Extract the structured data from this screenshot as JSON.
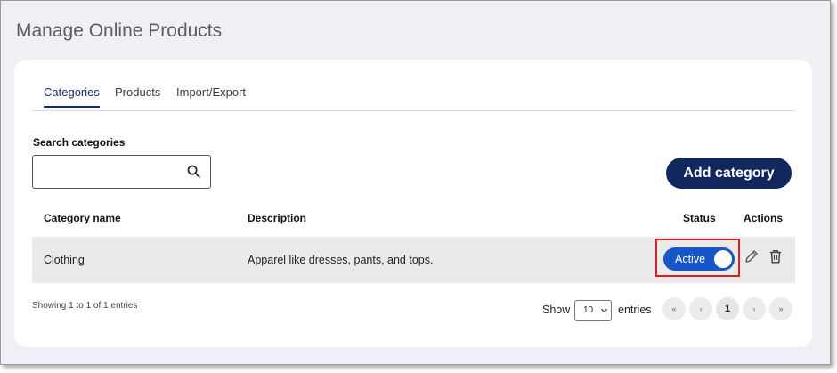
{
  "page": {
    "title": "Manage Online Products"
  },
  "tabs": [
    {
      "label": "Categories",
      "active": true
    },
    {
      "label": "Products",
      "active": false
    },
    {
      "label": "Import/Export",
      "active": false
    }
  ],
  "search": {
    "label": "Search categories",
    "value": "",
    "placeholder": "",
    "icon": "search-icon"
  },
  "toolbar": {
    "add_label": "Add category",
    "add_color": "#12275e"
  },
  "table": {
    "headers": {
      "name": "Category name",
      "description": "Description",
      "status": "Status",
      "actions": "Actions"
    },
    "rows": [
      {
        "name": "Clothing",
        "description": "Apparel like dresses, pants, and tops.",
        "status": "Active",
        "status_on": true
      }
    ]
  },
  "colors": {
    "accent": "#1656c8",
    "highlight": "#d81e2a",
    "row_bg": "#eaeaea"
  },
  "footer": {
    "info": "Showing 1 to 1 of 1 entries",
    "show_label": "Show",
    "page_size": "10",
    "entries_label": "entries",
    "pagination": {
      "first": "«",
      "prev": "‹",
      "current": "1",
      "next": "›",
      "last": "»"
    }
  }
}
